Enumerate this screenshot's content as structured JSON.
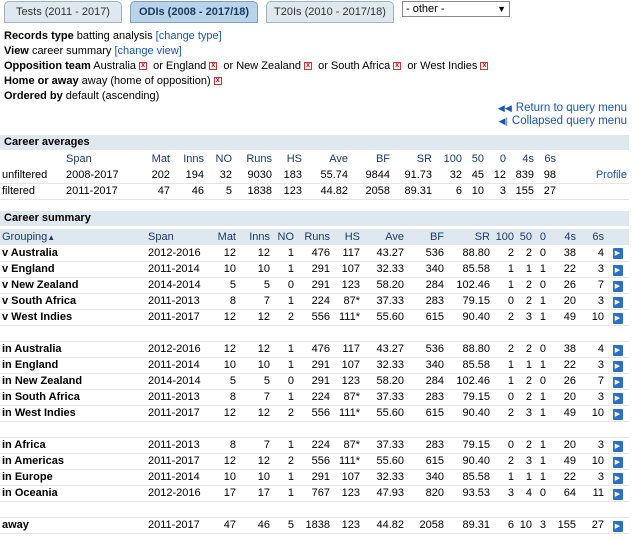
{
  "tabs": [
    {
      "label": "Tests (2011 - 2017)"
    },
    {
      "label": "ODIs (2008 - 2017/18)"
    },
    {
      "label": "T20Is (2010 - 2017/18)"
    }
  ],
  "other_select": {
    "value": "- other -"
  },
  "query": {
    "records_type_label": "Records type",
    "records_type_value": "batting analysis",
    "records_type_link": "[change type]",
    "view_label": "View",
    "view_value": "career summary",
    "view_link": "[change view]",
    "opposition_label": "Opposition team",
    "opposition_teams": [
      "Australia",
      "or England",
      "or New Zealand",
      "or South Africa",
      "or West Indies"
    ],
    "home_away_label": "Home or away",
    "home_away_value": "away (home of opposition)",
    "ordered_label": "Ordered by",
    "ordered_value": "default (ascending)"
  },
  "links": {
    "return_query": "Return to query menu",
    "collapsed_query": "Collapsed query menu"
  },
  "career_averages": {
    "title": "Career averages",
    "columns": [
      "",
      "Span",
      "Mat",
      "Inns",
      "NO",
      "Runs",
      "HS",
      "Ave",
      "BF",
      "SR",
      "100",
      "50",
      "0",
      "4s",
      "6s",
      ""
    ],
    "rows": [
      [
        "unfiltered",
        "2008-2017",
        "202",
        "194",
        "32",
        "9030",
        "183",
        "55.74",
        "9844",
        "91.73",
        "32",
        "45",
        "12",
        "839",
        "98",
        "Profile"
      ],
      [
        "filtered",
        "2011-2017",
        "47",
        "46",
        "5",
        "1838",
        "123",
        "44.82",
        "2058",
        "89.31",
        "6",
        "10",
        "3",
        "155",
        "27",
        ""
      ]
    ]
  },
  "career_summary": {
    "title": "Career summary",
    "columns": [
      "Grouping",
      "Span",
      "Mat",
      "Inns",
      "NO",
      "Runs",
      "HS",
      "Ave",
      "BF",
      "SR",
      "100",
      "50",
      "0",
      "4s",
      "6s"
    ],
    "groups": [
      [
        [
          "v Australia",
          "2012-2016",
          "12",
          "12",
          "1",
          "476",
          "117",
          "43.27",
          "536",
          "88.80",
          "2",
          "2",
          "0",
          "38",
          "4"
        ],
        [
          "v England",
          "2011-2014",
          "10",
          "10",
          "1",
          "291",
          "107",
          "32.33",
          "340",
          "85.58",
          "1",
          "1",
          "1",
          "22",
          "3"
        ],
        [
          "v New Zealand",
          "2014-2014",
          "5",
          "5",
          "0",
          "291",
          "123",
          "58.20",
          "284",
          "102.46",
          "1",
          "2",
          "0",
          "26",
          "7"
        ],
        [
          "v South Africa",
          "2011-2013",
          "8",
          "7",
          "1",
          "224",
          "87*",
          "37.33",
          "283",
          "79.15",
          "0",
          "2",
          "1",
          "20",
          "3"
        ],
        [
          "v West Indies",
          "2011-2017",
          "12",
          "12",
          "2",
          "556",
          "111*",
          "55.60",
          "615",
          "90.40",
          "2",
          "3",
          "1",
          "49",
          "10"
        ]
      ],
      [
        [
          "in Australia",
          "2012-2016",
          "12",
          "12",
          "1",
          "476",
          "117",
          "43.27",
          "536",
          "88.80",
          "2",
          "2",
          "0",
          "38",
          "4"
        ],
        [
          "in England",
          "2011-2014",
          "10",
          "10",
          "1",
          "291",
          "107",
          "32.33",
          "340",
          "85.58",
          "1",
          "1",
          "1",
          "22",
          "3"
        ],
        [
          "in New Zealand",
          "2014-2014",
          "5",
          "5",
          "0",
          "291",
          "123",
          "58.20",
          "284",
          "102.46",
          "1",
          "2",
          "0",
          "26",
          "7"
        ],
        [
          "in South Africa",
          "2011-2013",
          "8",
          "7",
          "1",
          "224",
          "87*",
          "37.33",
          "283",
          "79.15",
          "0",
          "2",
          "1",
          "20",
          "3"
        ],
        [
          "in West Indies",
          "2011-2017",
          "12",
          "12",
          "2",
          "556",
          "111*",
          "55.60",
          "615",
          "90.40",
          "2",
          "3",
          "1",
          "49",
          "10"
        ]
      ],
      [
        [
          "in Africa",
          "2011-2013",
          "8",
          "7",
          "1",
          "224",
          "87*",
          "37.33",
          "283",
          "79.15",
          "0",
          "2",
          "1",
          "20",
          "3"
        ],
        [
          "in Americas",
          "2011-2017",
          "12",
          "12",
          "2",
          "556",
          "111*",
          "55.60",
          "615",
          "90.40",
          "2",
          "3",
          "1",
          "49",
          "10"
        ],
        [
          "in Europe",
          "2011-2014",
          "10",
          "10",
          "1",
          "291",
          "107",
          "32.33",
          "340",
          "85.58",
          "1",
          "1",
          "1",
          "22",
          "3"
        ],
        [
          "in Oceania",
          "2012-2016",
          "17",
          "17",
          "1",
          "767",
          "123",
          "47.93",
          "820",
          "93.53",
          "3",
          "4",
          "0",
          "64",
          "11"
        ]
      ],
      [
        [
          "away",
          "2011-2017",
          "47",
          "46",
          "5",
          "1838",
          "123",
          "44.82",
          "2058",
          "89.31",
          "6",
          "10",
          "3",
          "155",
          "27"
        ]
      ]
    ]
  }
}
